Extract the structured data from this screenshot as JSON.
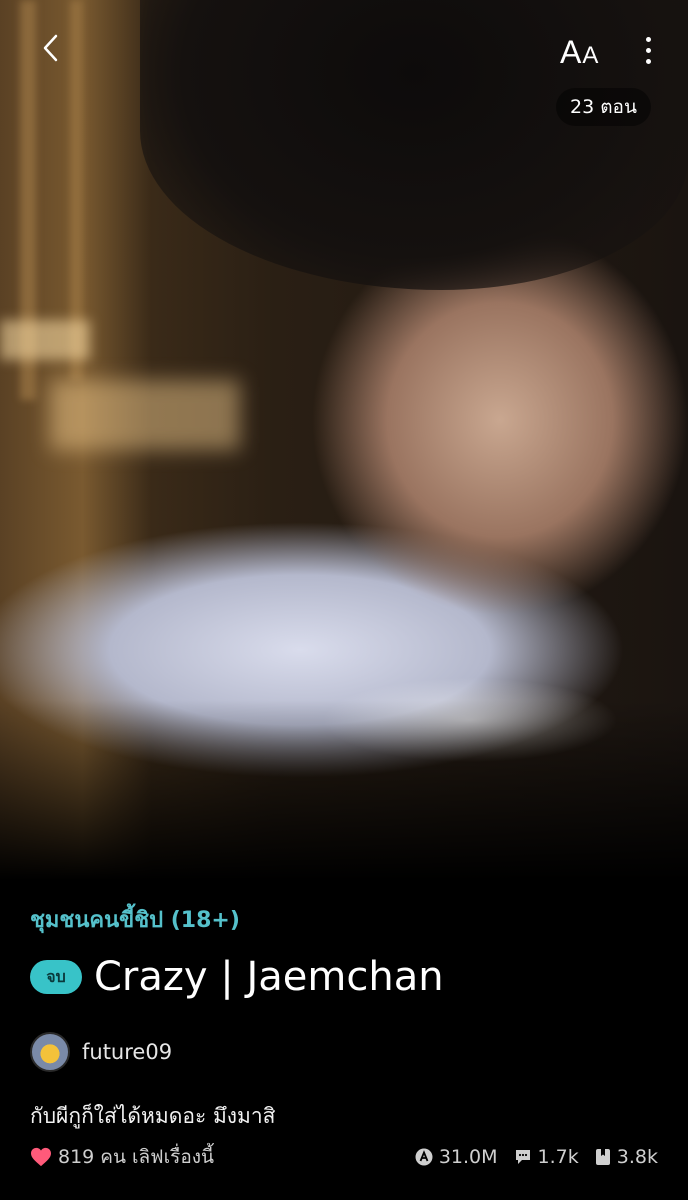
{
  "header": {
    "font_size_label_big": "A",
    "font_size_label_small": "A",
    "episodes_badge": "23 ตอน"
  },
  "story": {
    "category": "ชุมชนคนขี้ชิป (18+)",
    "status_badge": "จบ",
    "title": "Crazy | Jaemchan",
    "author": "future09",
    "description": "กับผีกูก็ใส่ได้หมดอะ มึงมาสิ",
    "likes_text": "819 คน เลิฟเรื่องนี้",
    "views": "31.0M",
    "comments": "1.7k",
    "bookmarks": "3.8k"
  },
  "colors": {
    "accent": "#55c1cb",
    "badge": "#38c3c8",
    "heart": "#ff5a7a"
  },
  "icons": [
    "back-chevron-icon",
    "font-size-icon",
    "more-vertical-icon",
    "heart-icon",
    "views-icon",
    "comment-icon",
    "bookmark-icon"
  ]
}
